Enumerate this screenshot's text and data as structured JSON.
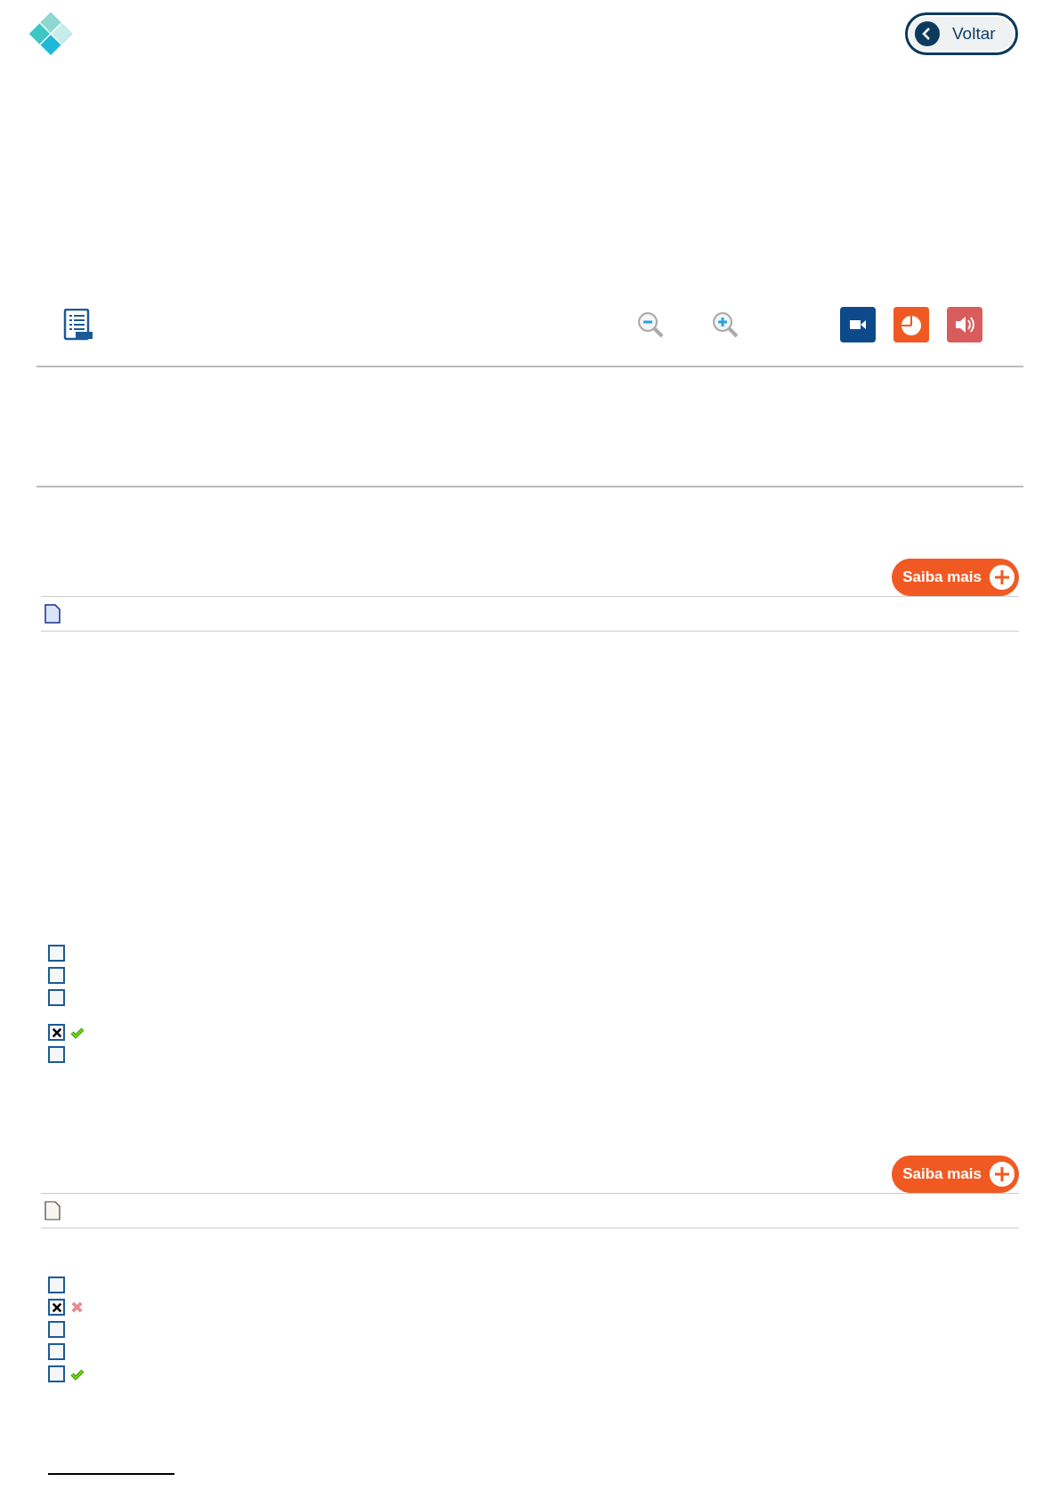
{
  "header": {
    "back_button": "Voltar"
  },
  "sections": [
    {
      "more_button": "Saiba mais",
      "document": {
        "kind": "blue"
      },
      "groups": [
        [
          {
            "checked": false,
            "kind": "plain"
          },
          {
            "checked": false,
            "kind": "plain"
          },
          {
            "checked": false,
            "kind": "plain"
          }
        ],
        [
          {
            "checked": true,
            "kind": "correct"
          },
          {
            "checked": false,
            "kind": "plain"
          }
        ]
      ]
    },
    {
      "more_button": "Saiba mais",
      "document": {
        "kind": "plain"
      },
      "groups": [
        [
          {
            "checked": false,
            "kind": "plain"
          },
          {
            "checked": true,
            "kind": "wrong"
          },
          {
            "checked": false,
            "kind": "plain"
          },
          {
            "checked": false,
            "kind": "plain"
          },
          {
            "checked": false,
            "kind": "correct"
          }
        ]
      ]
    }
  ]
}
